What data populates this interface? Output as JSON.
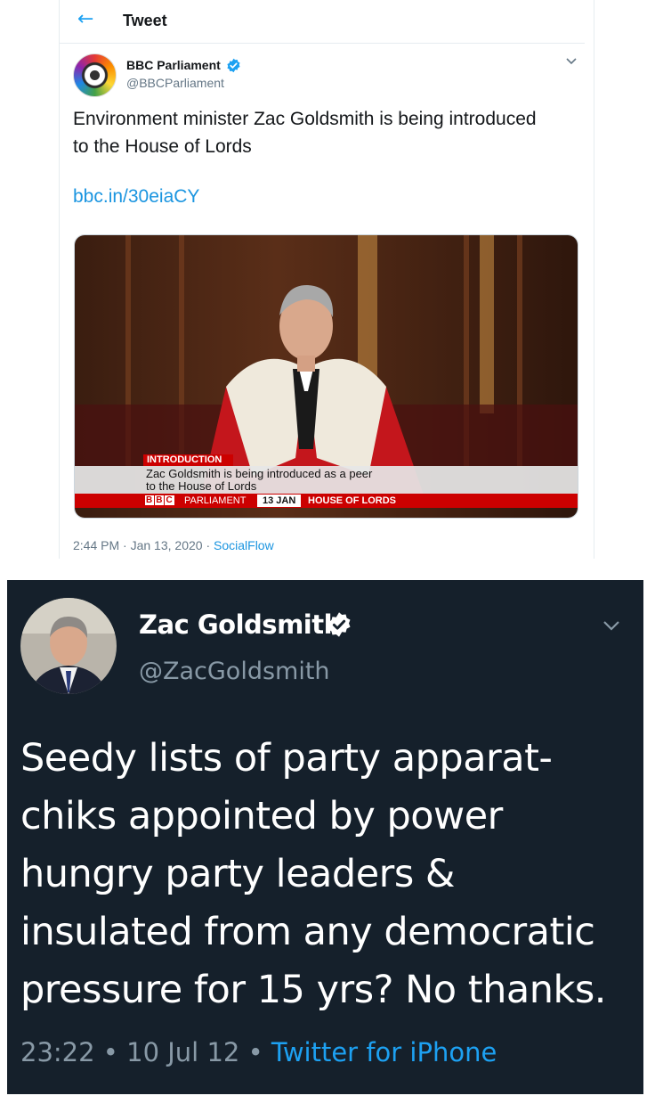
{
  "top_tweet": {
    "header": {
      "back_icon": "arrow-left-icon",
      "title": "Tweet"
    },
    "author": {
      "name": "BBC Parliament",
      "handle": "@BBCParliament",
      "verified": true
    },
    "text": "Environment minister Zac Goldsmith is being introduced to the House of Lords",
    "link": "bbc.in/30eiaCY",
    "media": {
      "lower_third": {
        "tag": "INTRODUCTION",
        "line1": "Zac Goldsmith is being introduced as a peer",
        "line2": "to the House of Lords",
        "channel_logo": "BBC",
        "channel": "PARLIAMENT",
        "date": "13 JAN",
        "location": "HOUSE OF LORDS"
      }
    },
    "meta": {
      "time": "2:44 PM",
      "date": "Jan 13, 2020",
      "source": "SocialFlow",
      "sep": "·"
    }
  },
  "bottom_tweet": {
    "author": {
      "name": "Zac Goldsmith",
      "handle": "@ZacGoldsmith",
      "verified": true
    },
    "text": "Seedy lists of party apparat-chiks appointed by power hungry party leaders & insulated from any democratic pressure for 15 yrs? No thanks.",
    "meta": {
      "time": "23:22",
      "date": "10 Jul 12",
      "source": "Twitter for iPhone",
      "sep": "•"
    }
  },
  "colors": {
    "accent": "#1da1f2",
    "dark_bg": "#15202b",
    "secondary_text": "#657786",
    "bbc_red": "#cc0000"
  }
}
